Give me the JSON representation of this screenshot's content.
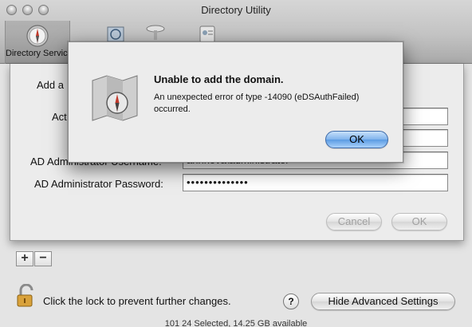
{
  "window": {
    "title": "Directory Utility",
    "toolbar": [
      {
        "label": "Directory Services",
        "icon": "compass-icon"
      },
      {
        "label": "",
        "icon": "services-icon"
      },
      {
        "label": "",
        "icon": "search-policy-icon"
      },
      {
        "label": "",
        "icon": "directory-editor-icon"
      }
    ]
  },
  "sheet": {
    "add_label": "Add a",
    "active_label": "Act",
    "ad_username_label": "AD Administrator Username:",
    "ad_username_value": "annnova\\administrator",
    "ad_password_label": "AD Administrator Password:",
    "ad_password_value": "••••••••••••••",
    "cancel_label": "Cancel",
    "ok_label": "OK"
  },
  "list_controls": {
    "add": "+",
    "remove": "−"
  },
  "footer": {
    "lock_text": "Click the lock to prevent further changes.",
    "help_label": "?",
    "advanced_button": "Hide Advanced Settings",
    "status_text": "101 24 Selected, 14.25 GB available"
  },
  "alert": {
    "title": "Unable to add the domain.",
    "message": "An unexpected error of type -14090 (eDSAuthFailed) occurred.",
    "ok_label": "OK"
  }
}
